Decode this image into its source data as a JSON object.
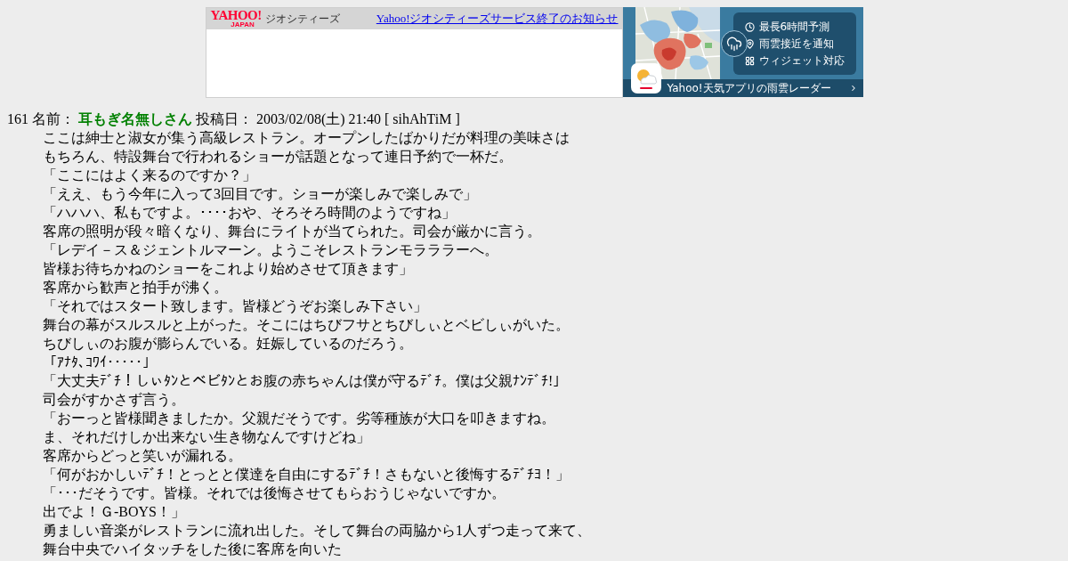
{
  "banner": {
    "logo": "YAHOO!",
    "logo_subtext": "JAPAN",
    "service": "ジオシティーズ",
    "notice_link": "Yahoo!ジオシティーズサービス終了のお知らせ"
  },
  "ad": {
    "features": [
      {
        "kind": "clock",
        "label": "最長6時間予測"
      },
      {
        "kind": "pin",
        "label": "雨雲接近を通知"
      },
      {
        "kind": "widget",
        "label": "ウィジェット対応"
      }
    ],
    "caption": "Yahoo!天気アプリの雨雲レーダー"
  },
  "post": {
    "number": "161",
    "name_label": "名前：",
    "name": "耳もぎ名無しさん",
    "date_label": "投稿日：",
    "date": "2003/02/08(土) 21:40",
    "id": "[ sihAhTiM ]",
    "body": [
      "ここは紳士と淑女が集う高級レストラン。オープンしたばかりだが料理の美味さは",
      "もちろん、特設舞台で行われるショーが話題となって連日予約で一杯だ。",
      "「ここにはよく来るのですか？」",
      "「ええ、もう今年に入って3回目です。ショーが楽しみで楽しみで」",
      "「ハハハ、私もですよ。････おや、そろそろ時間のようですね」",
      "客席の照明が段々暗くなり、舞台にライトが当てられた。司会が厳かに言う。",
      "「レデイ－ス＆ジェントルマーン。ようこそレストランモラララーへ。",
      "皆様お待ちかねのショーをこれより始めさせて頂きます」",
      "客席から歓声と拍手が沸く。",
      "「それではスタート致します。皆様どうぞお楽しみ下さい」",
      "舞台の幕がスルスルと上がった。そこにはちびフサとちびしぃとベビしぃがいた。",
      "ちびしぃのお腹が膨らんでいる。妊娠しているのだろう。",
      "「ｱﾅﾀ､ｺﾜｲ･････」",
      "「大丈夫ﾃﾞﾁ！しぃﾀﾝとベビﾀﾝとお腹の赤ちゃんは僕が守るﾃﾞﾁ。僕は父親ﾅﾝﾃﾞﾁ!」",
      "司会がすかさず言う。",
      "「おーっと皆様聞きましたか。父親だそうです。劣等種族が大口を叩きますね。",
      "ま、それだけしか出来ない生き物なんですけどね」",
      "客席からどっと笑いが漏れる。",
      "「何がおかしいﾃﾞﾁ！とっとと僕達を自由にするﾃﾞﾁ！さもないと後悔するﾃﾞﾁﾖ！」",
      "「･･･だそうです。皆様。それでは後悔させてもらおうじゃないですか。",
      "出でよ！Ｇ-BOYS！」",
      "勇ましい音楽がレストランに流れ出した。そして舞台の両脇から1人ずつ走って来て、",
      "舞台中央でハイタッチをした後に客席を向いた"
    ]
  }
}
